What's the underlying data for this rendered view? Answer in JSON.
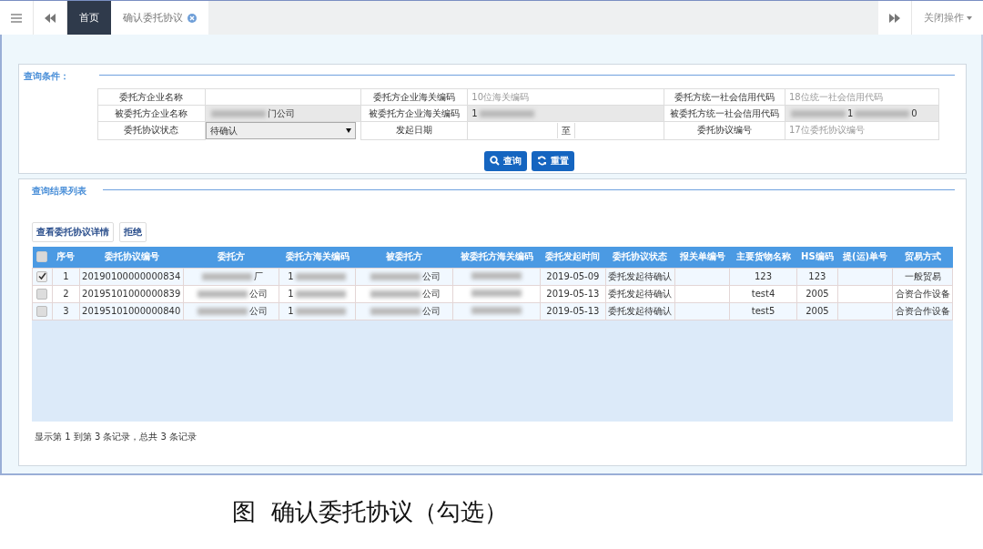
{
  "tabbar": {
    "tabs": [
      {
        "label": "首页",
        "selected": false,
        "closable": false
      },
      {
        "label": "确认委托协议",
        "selected": true,
        "closable": true
      }
    ],
    "close_menu": "关闭操作"
  },
  "query": {
    "title": "查询条件：",
    "rows": [
      [
        {
          "label": "委托方企业名称",
          "kind": "text"
        },
        {
          "label": "委托方企业海关编码",
          "kind": "text",
          "placeholder": "10位海关编码"
        },
        {
          "label": "委托方统一社会信用代码",
          "kind": "text",
          "placeholder": "18位统一社会信用代码"
        }
      ],
      [
        {
          "label": "被委托方企业名称",
          "kind": "text",
          "value": "门公司",
          "redacted": true,
          "disabled": true
        },
        {
          "label": "被委托方企业海关编码",
          "kind": "text",
          "value": "1",
          "redacted": true,
          "disabled": true
        },
        {
          "label": "被委托方统一社会信用代码",
          "kind": "text",
          "value": "1",
          "value_end": "0",
          "redacted": true,
          "disabled": true
        }
      ],
      [
        {
          "label": "委托协议状态",
          "kind": "select",
          "value": "待确认"
        },
        {
          "label": "发起日期",
          "kind": "date",
          "separator": "至"
        },
        {
          "label": "委托协议编号",
          "kind": "text",
          "placeholder": "17位委托协议编号"
        }
      ]
    ],
    "buttons": [
      {
        "label": "查询",
        "kind": "search"
      },
      {
        "label": "重置",
        "kind": "reset"
      }
    ]
  },
  "results": {
    "title": "查询结果列表",
    "actions": [
      "查看委托协议详情",
      "拒绝"
    ],
    "select_all_checked": false,
    "columns": [
      "序号",
      "委托协议编号",
      "委托方",
      "委托方海关编码",
      "被委托方",
      "被委托方海关编码",
      "委托发起时间",
      "委托协议状态",
      "报关单编号",
      "主要货物名称",
      "HS编码",
      "提(运)单号",
      "贸易方式"
    ],
    "rows": [
      {
        "checked": true,
        "cells": [
          {
            "text": "1"
          },
          {
            "text": "20190100000000834"
          },
          {
            "text": "厂",
            "redacted": true
          },
          {
            "text": "1",
            "redacted": true
          },
          {
            "text": "公司",
            "redacted": true
          },
          {
            "redacted": true
          },
          {
            "text": "2019-05-09"
          },
          {
            "text": "委托发起待确认"
          },
          {},
          {
            "text": "123"
          },
          {
            "text": "123"
          },
          {},
          {
            "text": "一般贸易"
          }
        ]
      },
      {
        "checked": false,
        "cells": [
          {
            "text": "2"
          },
          {
            "text": "20195101000000839"
          },
          {
            "text": "公司",
            "redacted": true
          },
          {
            "text": "1",
            "redacted": true
          },
          {
            "text": "公司",
            "redacted": true
          },
          {
            "redacted": true
          },
          {
            "text": "2019-05-13"
          },
          {
            "text": "委托发起待确认"
          },
          {},
          {
            "text": "test4"
          },
          {
            "text": "2005"
          },
          {},
          {
            "text": "合资合作设备"
          }
        ]
      },
      {
        "checked": false,
        "cells": [
          {
            "text": "3"
          },
          {
            "text": "20195101000000840"
          },
          {
            "text": "公司",
            "redacted": true
          },
          {
            "text": "1",
            "redacted": true
          },
          {
            "text": "公司",
            "redacted": true
          },
          {
            "redacted": true
          },
          {
            "text": "2019-05-13"
          },
          {
            "text": "委托发起待确认"
          },
          {},
          {
            "text": "test5"
          },
          {
            "text": "2005"
          },
          {},
          {
            "text": "合资合作设备"
          }
        ]
      }
    ],
    "footer": "显示第 1 到第 3 条记录，总共 3 条记录"
  },
  "caption": "图  确认委托协议（勾选）"
}
